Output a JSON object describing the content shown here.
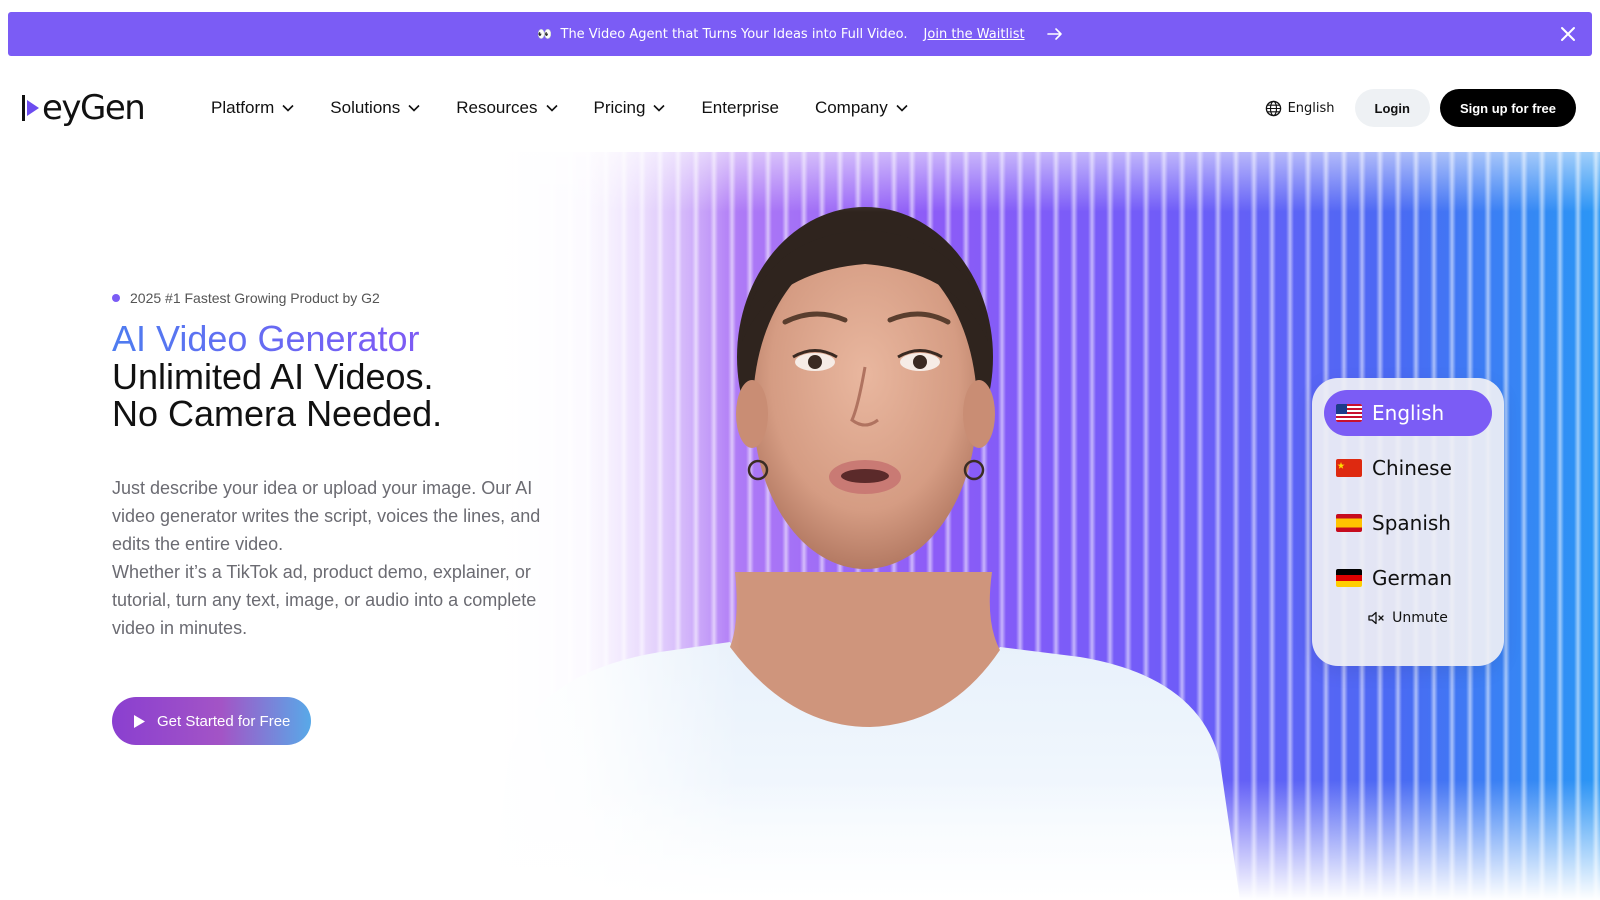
{
  "banner": {
    "emoji": "👀",
    "text": "The Video Agent that Turns Your Ideas into Full Video.",
    "link_label": "Join the Waitlist",
    "arrow_icon": "arrow-right-icon",
    "close_icon": "close-icon",
    "bg_color": "#7b5cf5"
  },
  "brand": {
    "logo_text": "eyGen",
    "logo_aria": "HeyGen"
  },
  "nav": {
    "items": [
      {
        "label": "Platform",
        "has_dropdown": true
      },
      {
        "label": "Solutions",
        "has_dropdown": true
      },
      {
        "label": "Resources",
        "has_dropdown": true
      },
      {
        "label": "Pricing",
        "has_dropdown": true
      },
      {
        "label": "Enterprise",
        "has_dropdown": false
      },
      {
        "label": "Company",
        "has_dropdown": true
      }
    ],
    "language_label": "English",
    "language_icon": "globe-icon",
    "login_label": "Login",
    "signup_label": "Sign up for free"
  },
  "hero": {
    "badge": "2025 #1 Fastest Growing Product by G2",
    "headline_gradient": "AI Video Generator",
    "headline_line2": "Unlimited AI Videos.",
    "headline_line3": "No Camera Needed.",
    "description_1": "Just describe your idea or upload your image. Our AI video generator writes the script, voices the lines, and edits the entire video.",
    "description_2": "Whether it’s a TikTok ad, product demo, explainer, or tutorial, turn any text, image, or audio into a complete video in minutes.",
    "cta_label": "Get Started for Free",
    "cta_icon": "play-icon"
  },
  "language_selector": {
    "options": [
      {
        "flag": "us-flag-icon",
        "label": "English",
        "active": true
      },
      {
        "flag": "cn-flag-icon",
        "label": "Chinese",
        "active": false
      },
      {
        "flag": "es-flag-icon",
        "label": "Spanish",
        "active": false
      },
      {
        "flag": "de-flag-icon",
        "label": "German",
        "active": false
      }
    ],
    "unmute_label": "Unmute",
    "unmute_icon": "muted-speaker-icon",
    "active_color": "#7b5cf5"
  }
}
